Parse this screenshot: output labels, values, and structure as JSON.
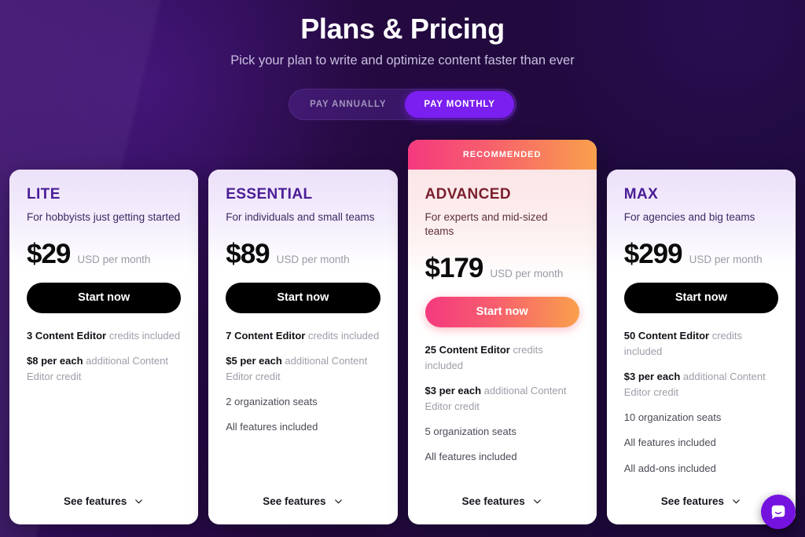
{
  "header": {
    "title": "Plans & Pricing",
    "subtitle": "Pick your plan to write and optimize content faster than ever"
  },
  "billing_toggle": {
    "annual_label": "PAY ANNUALLY",
    "monthly_label": "PAY MONTHLY",
    "selected": "PAY MONTHLY"
  },
  "colors": {
    "page_bg_dark": "#1e0a3c",
    "page_bg_light": "#3a1168",
    "accent_purple": "#7b1ff0",
    "plan_title_purple": "#4a1d96",
    "featured_title_maroon": "#7a1f2e",
    "gradient_start": "#f4397f",
    "gradient_end": "#f9a04c",
    "chat_launcher": "#7412e0"
  },
  "plans": [
    {
      "name": "LITE",
      "tagline": "For hobbyists just getting started",
      "price": "$29",
      "price_unit": "USD per month",
      "cta_label": "Start now",
      "recommended": false,
      "ribbon_label": "",
      "see_features_label": "See features",
      "features": [
        {
          "bold": "3 Content Editor",
          "rest": " credits included"
        },
        {
          "bold": "$8 per each",
          "rest": " additional Content Editor credit"
        }
      ],
      "plain_features": []
    },
    {
      "name": "ESSENTIAL",
      "tagline": "For individuals and small teams",
      "price": "$89",
      "price_unit": "USD per month",
      "cta_label": "Start now",
      "recommended": false,
      "ribbon_label": "",
      "see_features_label": "See features",
      "features": [
        {
          "bold": "7 Content Editor",
          "rest": " credits included"
        },
        {
          "bold": "$5 per each",
          "rest": " additional Content Editor credit"
        }
      ],
      "plain_features": [
        "2 organization seats",
        "All features included"
      ]
    },
    {
      "name": "ADVANCED",
      "tagline": "For experts and mid-sized teams",
      "price": "$179",
      "price_unit": "USD per month",
      "cta_label": "Start now",
      "recommended": true,
      "ribbon_label": "RECOMMENDED",
      "see_features_label": "See features",
      "features": [
        {
          "bold": "25 Content Editor",
          "rest": " credits included"
        },
        {
          "bold": "$3 per each",
          "rest": " additional Content Editor credit"
        }
      ],
      "plain_features": [
        "5 organization seats",
        "All features included"
      ]
    },
    {
      "name": "MAX",
      "tagline": "For agencies and big teams",
      "price": "$299",
      "price_unit": "USD per month",
      "cta_label": "Start now",
      "recommended": false,
      "ribbon_label": "",
      "see_features_label": "See features",
      "features": [
        {
          "bold": "50 Content Editor",
          "rest": " credits included"
        },
        {
          "bold": "$3 per each",
          "rest": " additional Content Editor credit"
        }
      ],
      "plain_features": [
        "10 organization seats",
        "All features included",
        "All add-ons included"
      ]
    }
  ],
  "chat_widget": {
    "icon": "chat-bubble-smile-icon"
  }
}
